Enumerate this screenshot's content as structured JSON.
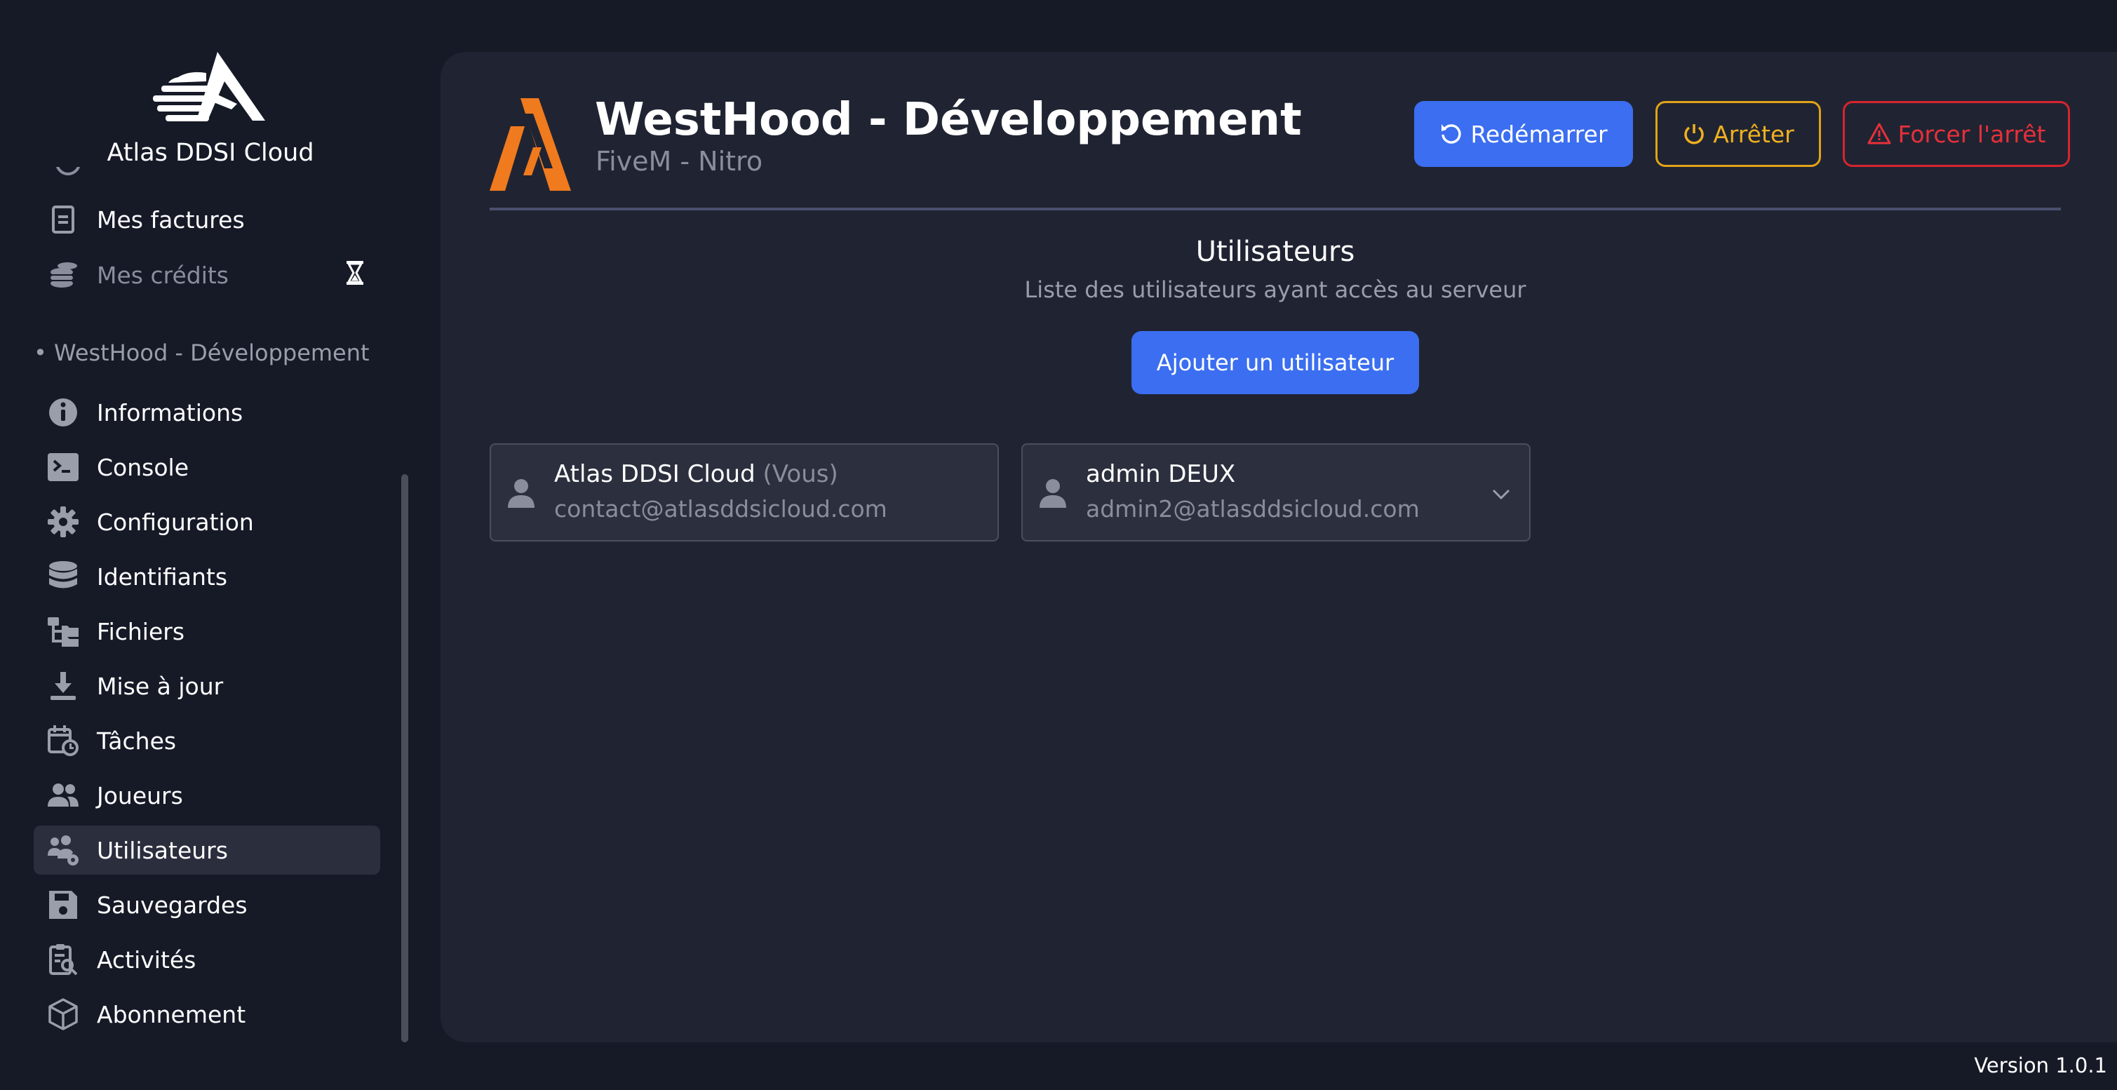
{
  "app": {
    "brand_name": "Atlas DDSI Cloud",
    "version": "Version 1.0.1"
  },
  "sidebar": {
    "account_items": [
      {
        "label": "Mes factures",
        "icon": "invoice-icon",
        "muted": false
      },
      {
        "label": "Mes crédits",
        "icon": "coins-icon",
        "muted": true,
        "badge_icon": "hourglass-icon"
      }
    ],
    "section_label": "• WestHood - Développement",
    "server_items": [
      {
        "label": "Informations",
        "icon": "info-icon"
      },
      {
        "label": "Console",
        "icon": "terminal-icon"
      },
      {
        "label": "Configuration",
        "icon": "gear-icon"
      },
      {
        "label": "Identifiants",
        "icon": "database-icon"
      },
      {
        "label": "Fichiers",
        "icon": "folder-tree-icon"
      },
      {
        "label": "Mise à jour",
        "icon": "download-icon"
      },
      {
        "label": "Tâches",
        "icon": "calendar-clock-icon"
      },
      {
        "label": "Joueurs",
        "icon": "users-icon"
      },
      {
        "label": "Utilisateurs",
        "icon": "users-gear-icon",
        "active": true
      },
      {
        "label": "Sauvegardes",
        "icon": "floppy-icon"
      },
      {
        "label": "Activités",
        "icon": "clipboard-search-icon"
      },
      {
        "label": "Abonnement",
        "icon": "cube-icon"
      }
    ]
  },
  "header": {
    "title": "WestHood - Développement",
    "subtitle": "FiveM - Nitro",
    "restart_label": "Redémarrer",
    "stop_label": "Arrêter",
    "kill_label": "Forcer l'arrêt"
  },
  "users_section": {
    "title": "Utilisateurs",
    "subtitle": "Liste des utilisateurs ayant accès au serveur",
    "add_label": "Ajouter un utilisateur",
    "users": [
      {
        "name": "Atlas DDSI Cloud",
        "you_tag": "(Vous)",
        "email": "contact@atlasddsicloud.com",
        "expandable": false
      },
      {
        "name": "admin DEUX",
        "you_tag": "",
        "email": "admin2@atlasddsicloud.com",
        "expandable": true
      }
    ]
  },
  "colors": {
    "accent_blue": "#3b6ef0",
    "stop_amber": "#e2a318",
    "kill_red": "#d8242e",
    "fivem_orange": "#f07a1e"
  }
}
